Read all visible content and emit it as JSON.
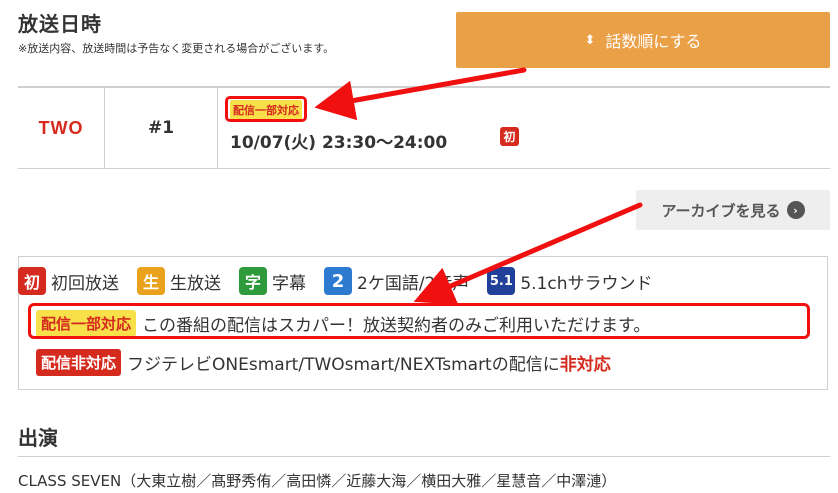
{
  "header": {
    "title": "放送日時",
    "notice": "※放送内容、放送時間は予告なく変更される場合がございます。",
    "sort_icon": "⬍",
    "sort_label": "話数順にする"
  },
  "episode": {
    "channel": "TWO",
    "number": "#1",
    "badge": "配信一部対応",
    "airdate": "10/07(火) 23:30～24:00",
    "first_icon": "初"
  },
  "archive": {
    "label": "アーカイブを見る",
    "icon": "›"
  },
  "legend": {
    "items": [
      {
        "icon": "初",
        "label": "初回放送"
      },
      {
        "icon": "生",
        "label": "生放送"
      },
      {
        "icon": "字",
        "label": "字幕"
      },
      {
        "icon": "2",
        "label": "2ケ国語/2音声"
      },
      {
        "icon": "5.1",
        "label": "5.1chサラウンド"
      }
    ],
    "partial_badge": "配信一部対応",
    "partial_text": "この番組の配信はスカパー！放送契約者のみご利用いただけます。",
    "none_badge": "配信非対応",
    "none_text": "フジテレビONEsmart/TWOsmart/NEXTsmartの配信に",
    "none_text_red": "非対応"
  },
  "cast": {
    "title": "出演",
    "text": "CLASS SEVEN（大東立樹／髙野秀侑／高田憐／近藤大海／横田大雅／星慧音／中澤漣）"
  },
  "colors": {
    "accent": "#eaa046",
    "brand_red": "#d52a1e",
    "annotation": "#f01010"
  }
}
